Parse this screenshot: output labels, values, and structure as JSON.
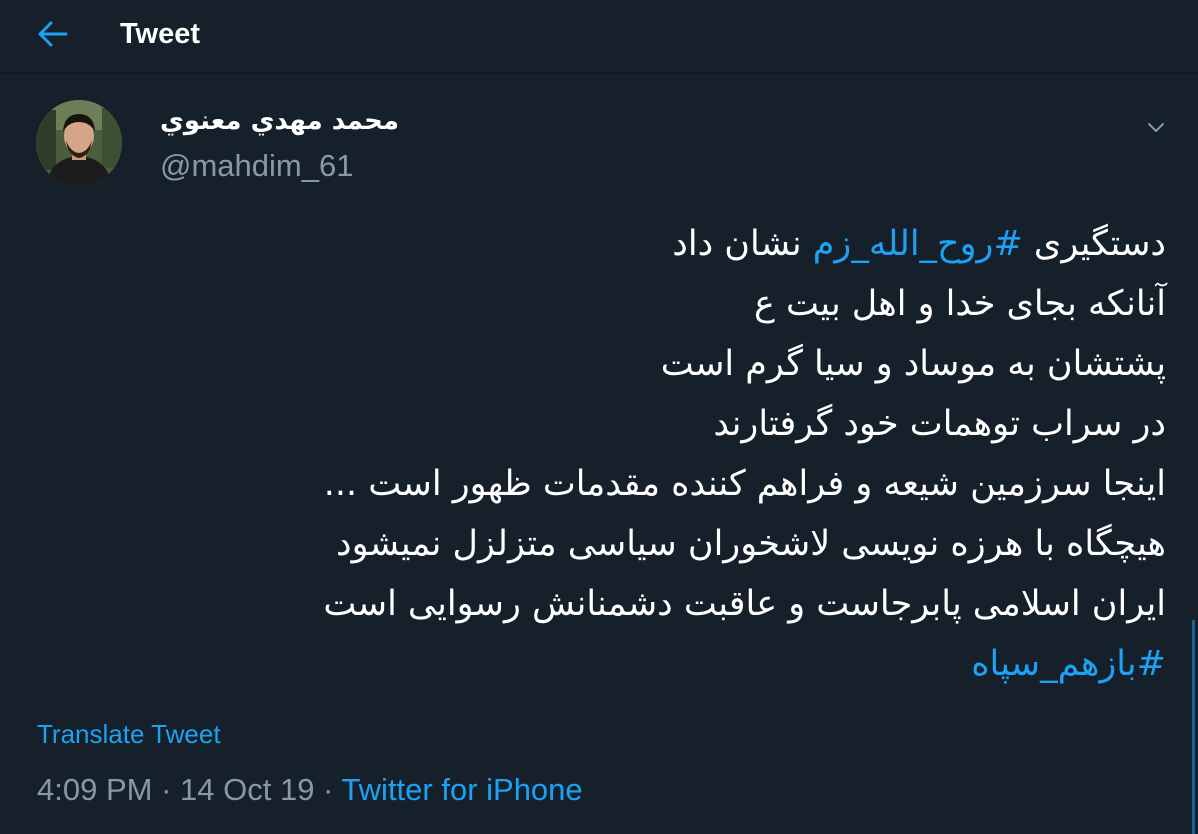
{
  "header": {
    "title": "Tweet"
  },
  "tweet": {
    "display_name": "محمد مهدي معنوي",
    "handle": "@mahdim_61",
    "lines": [
      {
        "before": "دستگیری ",
        "hashtag": "#روح_الله_زم",
        "after": " نشان داد"
      },
      {
        "text": "آنانکه بجای خدا و اهل بیت ع"
      },
      {
        "text": "پشتشان به موساد و سیا گرم است"
      },
      {
        "text": "در سراب توهمات خود گرفتارند"
      },
      {
        "text": "اینجا سرزمین شیعه و فراهم کننده مقدمات ظهور است ..."
      },
      {
        "text": "هیچگاه با هرزه نویسی لاشخوران سیاسی متزلزل نمیشود"
      },
      {
        "text": "ایران اسلامی پابرجاست و عاقبت دشمنانش رسوایی است"
      },
      {
        "hashtag": "#بازهم_سپاه"
      }
    ],
    "translate_label": "Translate Tweet",
    "time": "4:09 PM",
    "date": "14 Oct 19",
    "separator": " · ",
    "source": "Twitter for iPhone"
  },
  "colors": {
    "background": "#15202b",
    "accent": "#1da1f2",
    "secondary_text": "#8899a6"
  },
  "icons": {
    "back": "back-arrow-icon",
    "caret": "chevron-down-icon"
  }
}
